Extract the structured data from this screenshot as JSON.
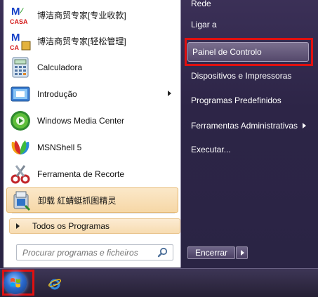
{
  "programs": [
    {
      "label": "博洁商贸专家[专业收款]",
      "icon": "madcasa-app-icon"
    },
    {
      "label": "博洁商贸专家[轻松管理]",
      "icon": "madcasa-app-icon"
    },
    {
      "label": "Calculadora",
      "icon": "calculator-icon"
    },
    {
      "label": "Introdução",
      "icon": "getting-started-icon"
    },
    {
      "label": "Windows Media Center",
      "icon": "media-center-icon"
    },
    {
      "label": "MSNShell 5",
      "icon": "msn-butterfly-icon"
    },
    {
      "label": "Ferramenta de Recorte",
      "icon": "snipping-tool-icon"
    },
    {
      "label": "卸载 紅蜻蜓抓图精灵",
      "icon": "uninstall-icon"
    }
  ],
  "all_programs_label": "Todos os Programas",
  "search": {
    "placeholder": "Procurar programas e ficheiros"
  },
  "right_items": [
    "Rede",
    "Ligar a",
    "Painel de Controlo",
    "Dispositivos e Impressoras",
    "Programas Predefinidos",
    "Ferramentas Administrativas",
    "Executar..."
  ],
  "shutdown_label": "Encerrar",
  "colors": {
    "highlight_red": "#e01010",
    "menu_bg": "#2d2547",
    "selected_program_bg": "#f6d7a6"
  }
}
